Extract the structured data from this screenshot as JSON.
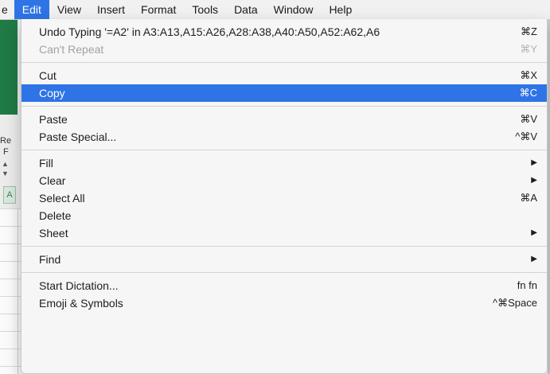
{
  "background": {
    "left_labels": [
      "Re",
      "F"
    ],
    "stepper": [
      "▲",
      "▼"
    ],
    "cell_ref": "A"
  },
  "menubar": {
    "items": [
      {
        "label": "e",
        "active": false
      },
      {
        "label": "Edit",
        "active": true
      },
      {
        "label": "View",
        "active": false
      },
      {
        "label": "Insert",
        "active": false
      },
      {
        "label": "Format",
        "active": false
      },
      {
        "label": "Tools",
        "active": false
      },
      {
        "label": "Data",
        "active": false
      },
      {
        "label": "Window",
        "active": false
      },
      {
        "label": "Help",
        "active": false
      }
    ]
  },
  "edit_menu": {
    "groups": [
      [
        {
          "label": "Undo Typing '=A2' in A3:A13,A15:A26,A28:A38,A40:A50,A52:A62,A6",
          "shortcut": "⌘Z",
          "disabled": false
        },
        {
          "label": "Can't Repeat",
          "shortcut": "⌘Y",
          "disabled": true
        }
      ],
      [
        {
          "label": "Cut",
          "shortcut": "⌘X"
        },
        {
          "label": "Copy",
          "shortcut": "⌘C",
          "highlighted": true
        }
      ],
      [
        {
          "label": "Paste",
          "shortcut": "⌘V"
        },
        {
          "label": "Paste Special...",
          "shortcut": "^⌘V"
        }
      ],
      [
        {
          "label": "Fill",
          "shortcut": "▶"
        },
        {
          "label": "Clear",
          "shortcut": "▶"
        },
        {
          "label": "Select All",
          "shortcut": "⌘A"
        },
        {
          "label": "Delete",
          "shortcut": ""
        },
        {
          "label": "Sheet",
          "shortcut": "▶"
        }
      ],
      [
        {
          "label": "Find",
          "shortcut": "▶"
        }
      ],
      [
        {
          "label": "Start Dictation...",
          "shortcut": "fn fn"
        },
        {
          "label": "Emoji & Symbols",
          "shortcut": "^⌘Space"
        }
      ]
    ]
  },
  "colors": {
    "highlight": "#2e74e6",
    "menu_bg": "#f6f6f6",
    "excel_green": "#1f7a45"
  }
}
